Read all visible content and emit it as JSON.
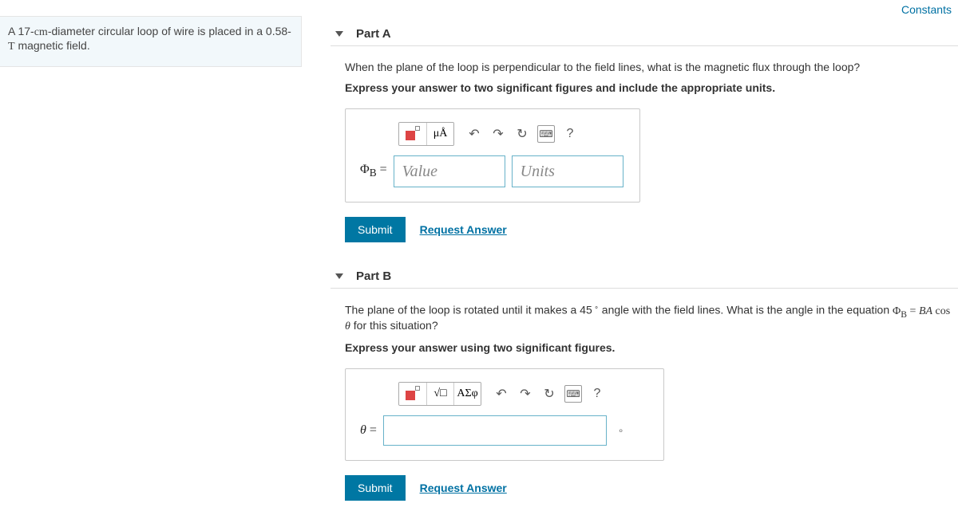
{
  "top_links": {
    "constants": "Constants"
  },
  "problem": {
    "text_before_diam": "A 17-",
    "diam_unit": "cm",
    "text_mid": "-diameter circular loop of wire is placed in a 0.58-",
    "field_unit": "T",
    "text_after": " magnetic field."
  },
  "parts": {
    "a": {
      "title": "Part A",
      "question": "When the plane of the loop is perpendicular to the field lines, what is the magnetic flux through the loop?",
      "instruction": "Express your answer to two significant figures and include the appropriate units.",
      "var_label": "Φ_B =",
      "value_placeholder": "Value",
      "units_placeholder": "Units",
      "toolbar": {
        "mu": "μÅ"
      },
      "submit": "Submit",
      "request": "Request Answer"
    },
    "b": {
      "title": "Part B",
      "question_pre": "The plane of the loop is rotated until it makes a 45",
      "question_post": " angle with the field lines. What is the angle in the equation Φ_B = BA cos θ for this situation?",
      "instruction": "Express your answer using two significant figures.",
      "var_label": "θ =",
      "toolbar": {
        "greek": "ΑΣφ"
      },
      "unit_suffix": "∘",
      "submit": "Submit",
      "request": "Request Answer"
    }
  },
  "icons": {
    "undo": "↶",
    "redo": "↷",
    "reset": "↻",
    "help": "?",
    "keyboard": "⌨"
  }
}
